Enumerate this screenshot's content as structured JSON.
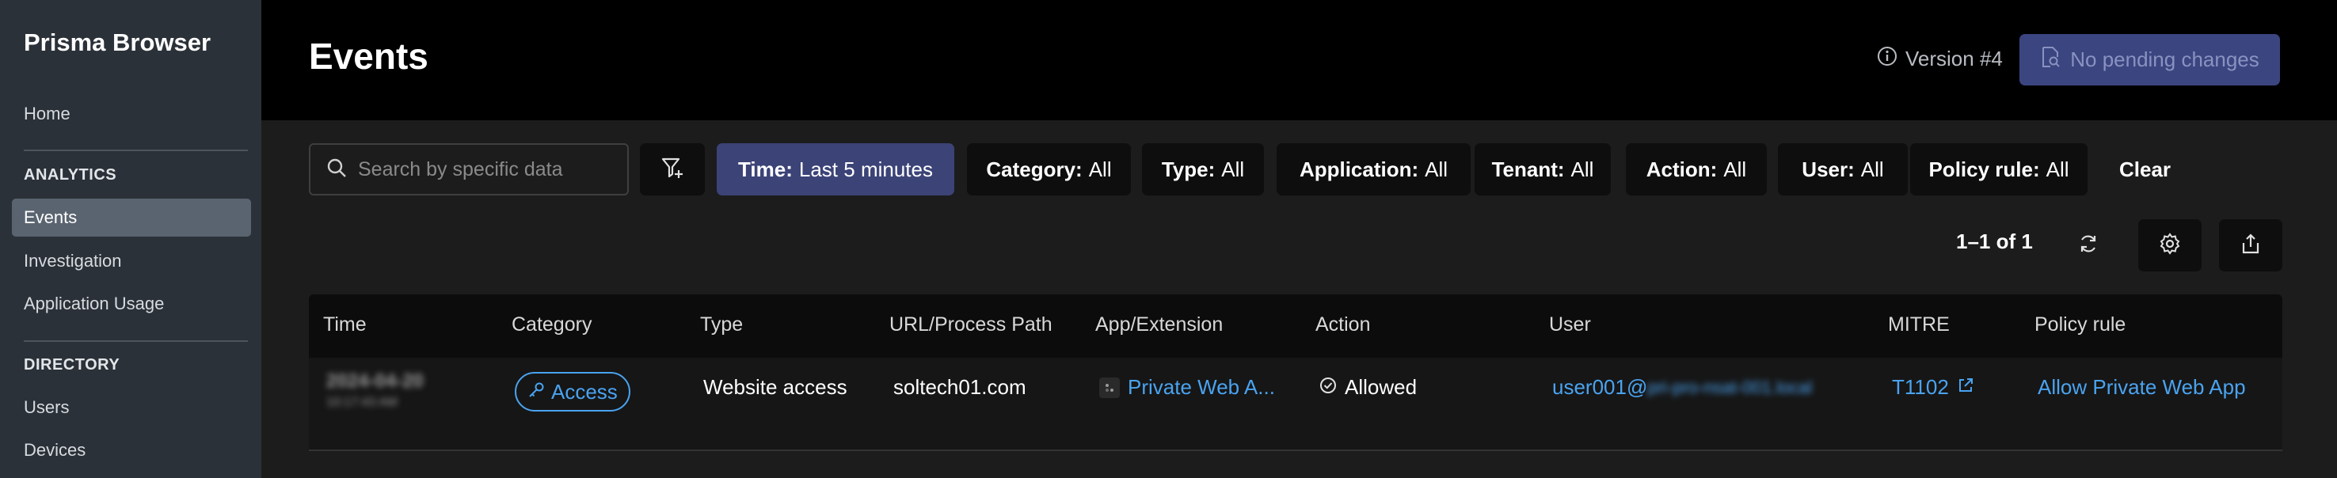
{
  "sidebar": {
    "brand": "Prisma Browser",
    "home": "Home",
    "analytics_heading": "ANALYTICS",
    "analytics_items": [
      "Events",
      "Investigation",
      "Application Usage"
    ],
    "directory_heading": "DIRECTORY",
    "directory_items": [
      "Users",
      "Devices"
    ]
  },
  "header": {
    "title": "Events",
    "version": "Version #4",
    "pending_label": "No pending changes"
  },
  "filters": {
    "search_placeholder": "Search by specific data",
    "chips": [
      {
        "key": "Time:",
        "value": "Last 5 minutes"
      },
      {
        "key": "Category:",
        "value": "All"
      },
      {
        "key": "Type:",
        "value": "All"
      },
      {
        "key": "Application:",
        "value": "All"
      },
      {
        "key": "Tenant:",
        "value": "All"
      },
      {
        "key": "Action:",
        "value": "All"
      },
      {
        "key": "User:",
        "value": "All"
      },
      {
        "key": "Policy rule:",
        "value": "All"
      }
    ],
    "clear_label": "Clear"
  },
  "pagination": {
    "range": "1–1 of 1"
  },
  "table": {
    "columns": [
      "Time",
      "Category",
      "Type",
      "URL/Process Path",
      "App/Extension",
      "Action",
      "User",
      "MITRE",
      "Policy rule"
    ],
    "rows": [
      {
        "time_date": "2024-04-20",
        "time_clock": "10:17:43 AM",
        "category": "Access",
        "type": "Website access",
        "url": "soltech01.com",
        "app": "Private Web A...",
        "action": "Allowed",
        "user_visible": "user001@",
        "user_domain": "pri-pro-nsat-001.local",
        "mitre": "T1102",
        "policy_rule": "Allow Private Web App"
      }
    ]
  },
  "colors": {
    "accent": "#4aa3f0",
    "time_chip": "#3b4377",
    "pending_button": "#3b4580",
    "sidebar_bg": "#2b3138"
  },
  "icons": [
    "info-icon",
    "document-search-icon",
    "search-icon",
    "filter-plus-icon",
    "refresh-icon",
    "gear-icon",
    "share-icon",
    "key-icon",
    "app-icon",
    "check-circle-icon",
    "external-link-icon"
  ]
}
